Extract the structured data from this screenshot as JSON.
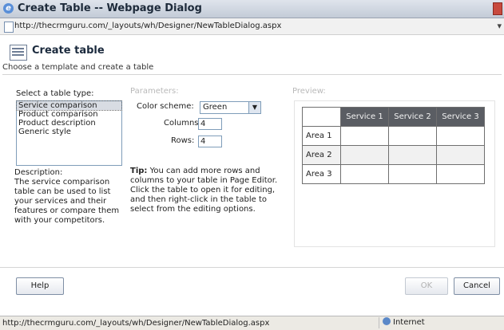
{
  "window": {
    "title": "Create Table -- Webpage Dialog"
  },
  "address": {
    "url": "http://thecrmguru.com/_layouts/wh/Designer/NewTableDialog.aspx"
  },
  "header": {
    "title": "Create table",
    "subtitle": "Choose a template and create a table"
  },
  "left": {
    "select_label": "Select a table type:",
    "items": [
      "Service comparison",
      "Product comparison",
      "Product description",
      "Generic style"
    ],
    "selected_index": 0,
    "description_label": "Description:",
    "description_text": "The service comparison table can be used to list your services and their features or compare them with your competitors."
  },
  "params": {
    "heading": "Parameters:",
    "color_label": "Color scheme:",
    "color_value": "Green",
    "columns_label": "Columns:",
    "columns_value": "4",
    "rows_label": "Rows:",
    "rows_value": "4",
    "tip_label": "Tip:",
    "tip_text": " You can add more rows and columns to your table in Page Editor. Click the table to open it for editing, and then right-click in the table to select from the editing options."
  },
  "preview": {
    "heading": "Preview:",
    "headers": [
      "Service 1",
      "Service 2",
      "Service 3"
    ],
    "rows": [
      "Area 1",
      "Area 2",
      "Area 3"
    ]
  },
  "buttons": {
    "help": "Help",
    "ok": "OK",
    "cancel": "Cancel"
  },
  "status": {
    "url": "http://thecrmguru.com/_layouts/wh/Designer/NewTableDialog.aspx",
    "zone": "Internet"
  }
}
